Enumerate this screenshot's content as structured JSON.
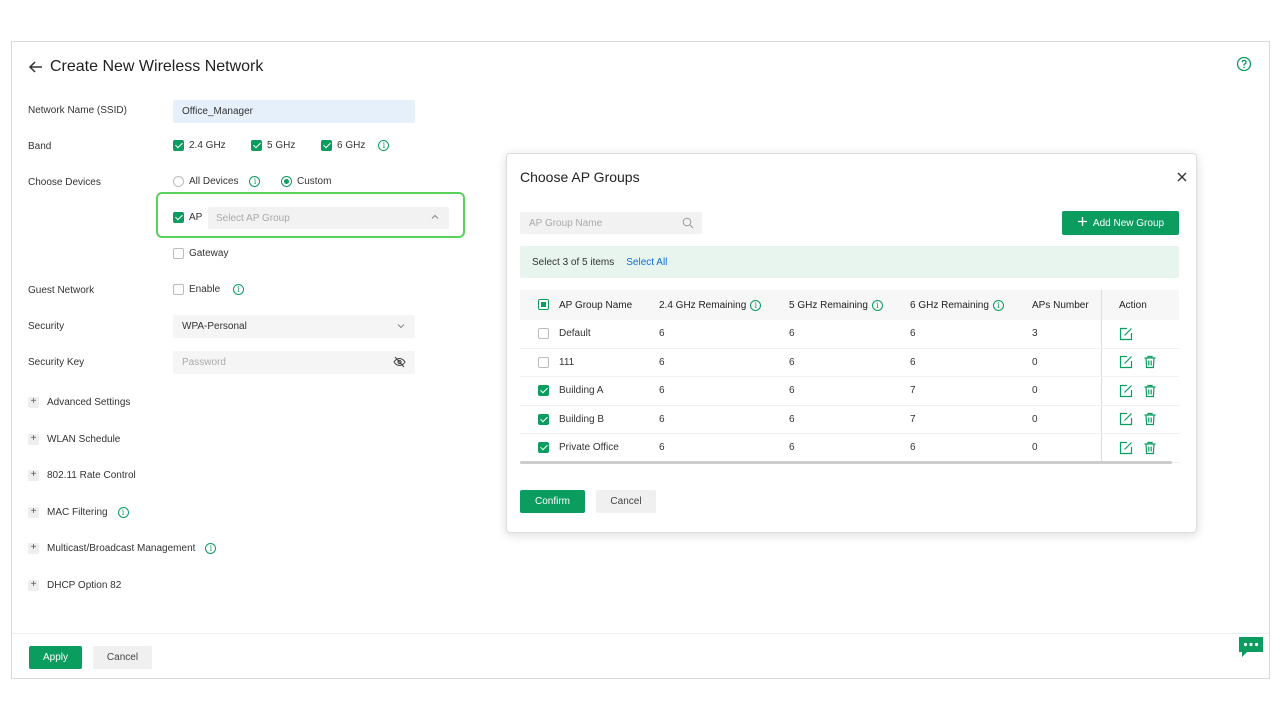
{
  "page": {
    "title": "Create New Wireless Network"
  },
  "form": {
    "ssid_label": "Network Name (SSID)",
    "ssid_value": "Office_Manager",
    "band_label": "Band",
    "bands": [
      {
        "label": "2.4 GHz",
        "checked": true
      },
      {
        "label": "5 GHz",
        "checked": true
      },
      {
        "label": "6 GHz",
        "checked": true
      }
    ],
    "devices_label": "Choose Devices",
    "device_options": [
      {
        "label": "All Devices",
        "selected": false
      },
      {
        "label": "Custom",
        "selected": true
      }
    ],
    "ap_label": "AP",
    "ap_checked": true,
    "ap_select_placeholder": "Select AP Group",
    "gateway_label": "Gateway",
    "gateway_checked": false,
    "guest_label": "Guest Network",
    "guest_enable_label": "Enable",
    "security_label": "Security",
    "security_value": "WPA-Personal",
    "key_label": "Security Key",
    "key_placeholder": "Password"
  },
  "advanced": [
    {
      "label": "Advanced Settings",
      "info": false
    },
    {
      "label": "WLAN Schedule",
      "info": false
    },
    {
      "label": "802.11 Rate Control",
      "info": false
    },
    {
      "label": "MAC Filtering",
      "info": true
    },
    {
      "label": "Multicast/Broadcast Management",
      "info": true
    },
    {
      "label": "DHCP Option 82",
      "info": false
    }
  ],
  "footer": {
    "apply_label": "Apply",
    "cancel_label": "Cancel"
  },
  "modal": {
    "title": "Choose AP Groups",
    "search_placeholder": "AP Group Name",
    "add_group_label": "Add New Group",
    "select_count_text": "Select 3 of 5 items",
    "select_all_label": "Select All",
    "columns": [
      "AP Group Name",
      "2.4 GHz Remaining",
      "5 GHz Remaining",
      "6 GHz Remaining",
      "APs Number",
      "Action"
    ],
    "rows": [
      {
        "name": "Default",
        "r24": "6",
        "r5": "6",
        "r6": "6",
        "aps": "3",
        "checked": false,
        "deletable": false
      },
      {
        "name": "111",
        "r24": "6",
        "r5": "6",
        "r6": "6",
        "aps": "0",
        "checked": false,
        "deletable": true
      },
      {
        "name": "Building A",
        "r24": "6",
        "r5": "6",
        "r6": "7",
        "aps": "0",
        "checked": true,
        "deletable": true
      },
      {
        "name": "Building B",
        "r24": "6",
        "r5": "6",
        "r6": "7",
        "aps": "0",
        "checked": true,
        "deletable": true
      },
      {
        "name": "Private Office",
        "r24": "6",
        "r5": "6",
        "r6": "6",
        "aps": "0",
        "checked": true,
        "deletable": true
      }
    ],
    "confirm_label": "Confirm",
    "cancel_label": "Cancel"
  },
  "colors": {
    "accent": "#0a9d5f",
    "highlight": "#5ad15a",
    "link": "#0a6fd8"
  }
}
